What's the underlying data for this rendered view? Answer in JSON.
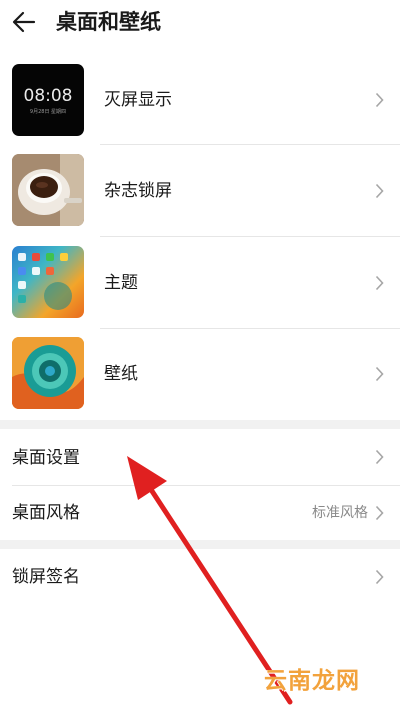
{
  "header": {
    "title": "桌面和壁纸"
  },
  "thumbs": {
    "aod": {
      "time": "08:08",
      "date": "9月28日 星期四"
    }
  },
  "items": [
    {
      "label": "灭屏显示"
    },
    {
      "label": "杂志锁屏"
    },
    {
      "label": "主题"
    },
    {
      "label": "壁纸"
    }
  ],
  "settings": [
    {
      "label": "桌面设置",
      "value": ""
    },
    {
      "label": "桌面风格",
      "value": "标准风格"
    },
    {
      "label": "锁屏签名",
      "value": ""
    }
  ],
  "watermark": "云南龙网",
  "colors": {
    "annotation_arrow": "#e02020",
    "watermark": "#f2a23c"
  }
}
